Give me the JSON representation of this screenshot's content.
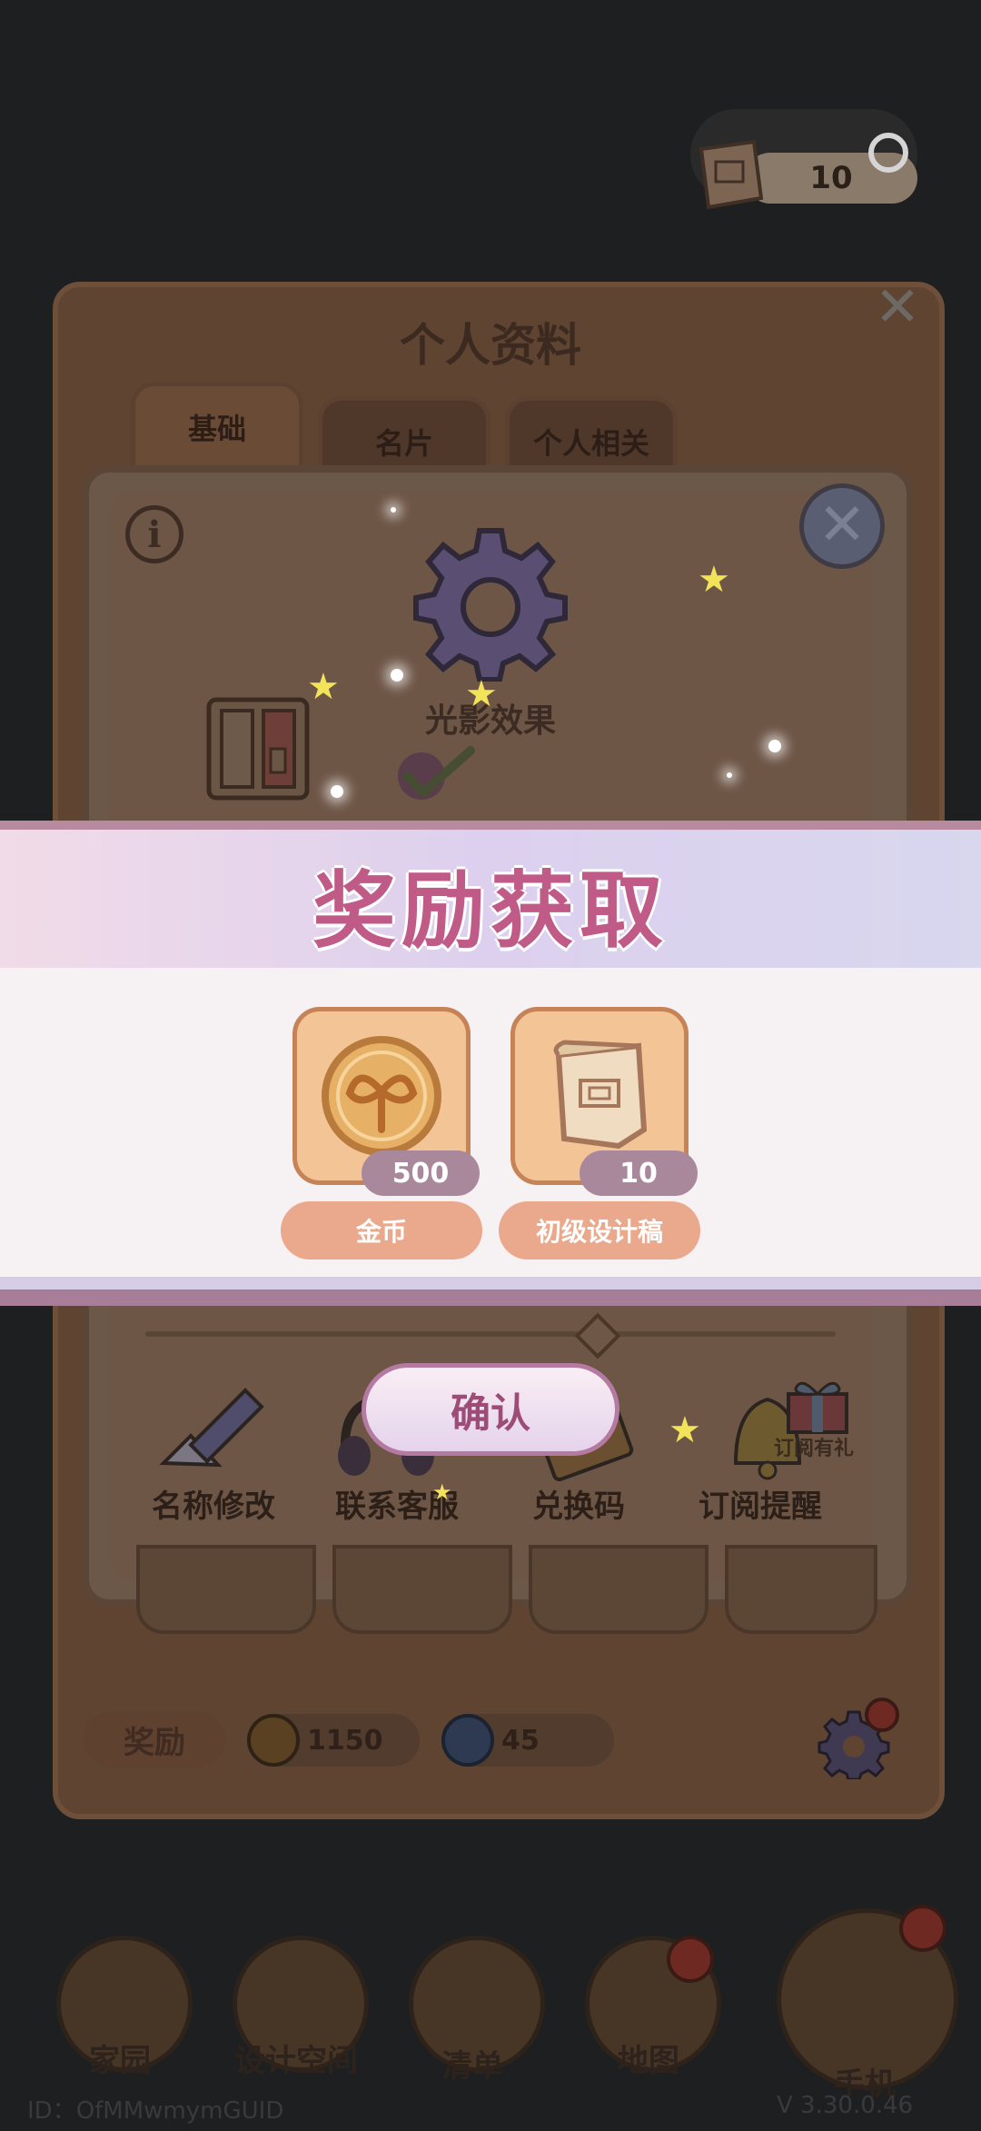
{
  "top_resource": {
    "count": "10",
    "icon": "scroll-blueprint-icon"
  },
  "profile_panel": {
    "title": "个人资料",
    "tabs": [
      "基础",
      "名片",
      "个人相关"
    ],
    "reward_label": "奖励",
    "coins": "1150",
    "swirl_count": "45"
  },
  "settings_popup": {
    "light_effect_label": "光影效果",
    "functions": [
      {
        "label": "名称修改",
        "icon": "pencil-icon"
      },
      {
        "label": "联系客服",
        "icon": "headset-icon"
      },
      {
        "label": "兑换码",
        "icon": "ticket-icon"
      },
      {
        "label": "订阅提醒",
        "icon": "bell-icon"
      }
    ],
    "gift_tag": "订阅有礼"
  },
  "reward_banner": {
    "title": "奖励获取",
    "items": [
      {
        "qty": "500",
        "name": "金币",
        "icon": "gold-coin-icon"
      },
      {
        "qty": "10",
        "name": "初级设计稿",
        "icon": "design-scroll-icon"
      }
    ],
    "confirm_label": "确认"
  },
  "bottom_nav": [
    {
      "label": "家园",
      "icon": "home-icon"
    },
    {
      "label": "设计空间",
      "icon": "design-icon"
    },
    {
      "label": "清单",
      "icon": "list-icon"
    },
    {
      "label": "地图",
      "icon": "map-pin-icon"
    },
    {
      "label": "手机",
      "icon": "phone-icon"
    }
  ],
  "footer": {
    "id_text": "ID：OfMMwmymGUID",
    "version": "V 3.30.0.46"
  },
  "colors": {
    "banner_title": "#c05a86",
    "card_bg": "#f3c495",
    "qty_badge": "#a9889c",
    "name_pill": "#eaa98c"
  }
}
